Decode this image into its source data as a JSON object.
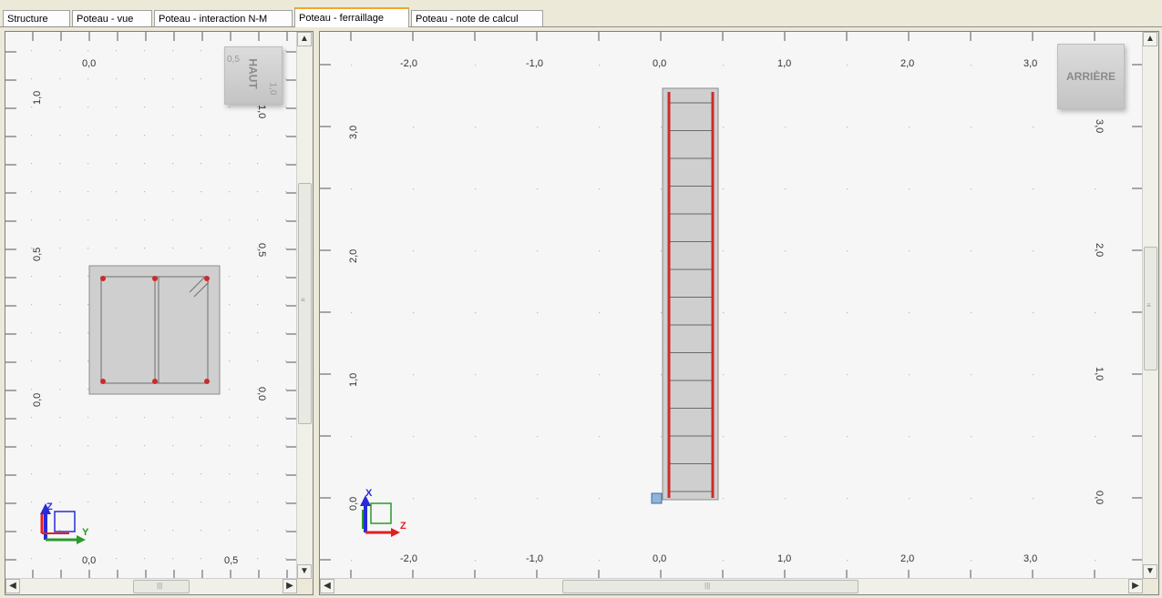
{
  "tabs": [
    {
      "label": "Structure",
      "active": false
    },
    {
      "label": "Poteau - vue",
      "active": false
    },
    {
      "label": "Poteau - interaction N-M",
      "active": false
    },
    {
      "label": "Poteau - ferraillage",
      "active": true
    },
    {
      "label": "Poteau - note de calcul",
      "active": false
    }
  ],
  "left_view": {
    "cube_label": "HAUT",
    "cube_side_labels": [
      "0,5",
      "1,0"
    ],
    "top_ticks": [
      "0,0"
    ],
    "bottom_ticks": [
      "0,0",
      "0,5"
    ],
    "left_ticks": [
      "1,0",
      "0,5",
      "0,0"
    ],
    "right_ticks": [
      "1,0",
      "0,5",
      "0,0"
    ],
    "axis_labels": {
      "vertical": "Z",
      "horizontal": "Y"
    }
  },
  "right_view": {
    "cube_label": "ARRIÈRE",
    "top_ticks": [
      "-2,0",
      "-1,0",
      "0,0",
      "1,0",
      "2,0",
      "3,0"
    ],
    "bottom_ticks": [
      "-2,0",
      "-1,0",
      "0,0",
      "1,0",
      "2,0",
      "3,0"
    ],
    "left_ticks": [
      "3,0",
      "2,0",
      "1,0",
      "0,0"
    ],
    "right_ticks": [
      "3,0",
      "2,0",
      "1,0",
      "0,0"
    ],
    "axis_labels": {
      "vertical": "X",
      "horizontal": "Z"
    }
  },
  "scroll_glyphs": {
    "up": "▲",
    "down": "▼",
    "left": "◀",
    "right": "▶",
    "grip_v": "≡",
    "grip_h": "|||"
  },
  "colors": {
    "rebar": "#cc2b2b",
    "concrete": "#cfcfcf",
    "grid_dot": "#b8b8b8",
    "axis_z": "#2a2ad8",
    "axis_y": "#2a9a2a",
    "axis_red": "#e02020",
    "active_tab": "#f5a623"
  }
}
